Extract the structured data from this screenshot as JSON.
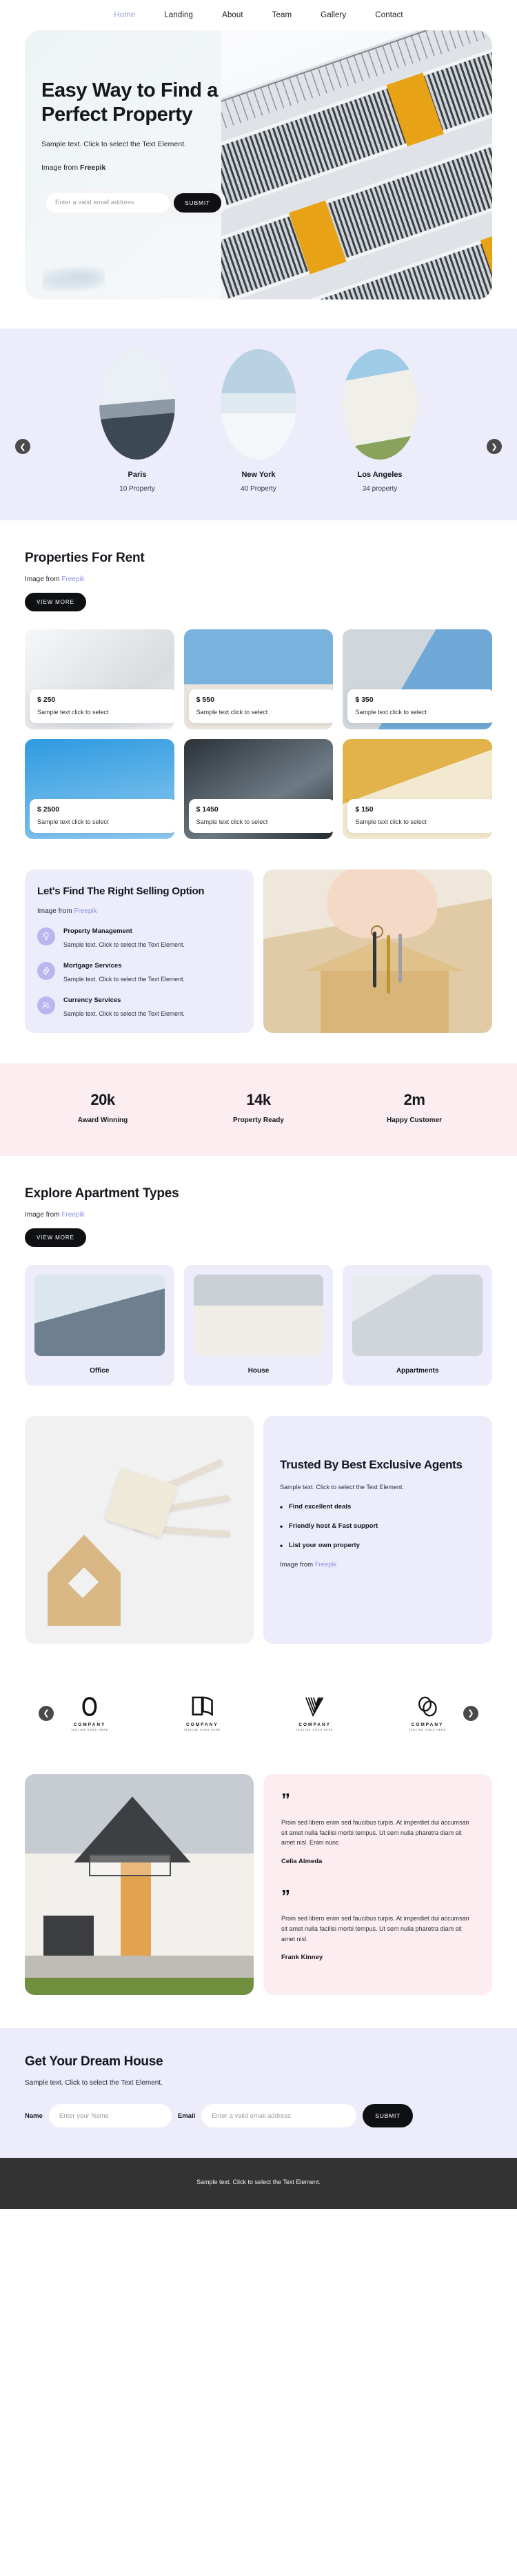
{
  "nav": {
    "items": [
      {
        "label": "Home",
        "active": true
      },
      {
        "label": "Landing",
        "active": false
      },
      {
        "label": "About",
        "active": false
      },
      {
        "label": "Team",
        "active": false
      },
      {
        "label": "Gallery",
        "active": false
      },
      {
        "label": "Contact",
        "active": false
      }
    ]
  },
  "hero": {
    "title": "Easy Way to Find a Perfect Property",
    "subtitle": "Sample text. Click to select the Text Element.",
    "credit_prefix": "Image from ",
    "credit_link": "Freepik",
    "email_placeholder": "Enter a valid email address",
    "submit_label": "SUBMIT"
  },
  "cities": {
    "prev_icon": "chevron-left-icon",
    "next_icon": "chevron-right-icon",
    "items": [
      {
        "name": "Paris",
        "count": "10 Property"
      },
      {
        "name": "New York",
        "count": "40 Property"
      },
      {
        "name": "Los Angeles",
        "count": "34 property"
      }
    ]
  },
  "properties": {
    "title": "Properties For Rent",
    "credit_prefix": "Image from ",
    "credit_link": "Freepik",
    "view_more_label": "VIEW MORE",
    "cards": [
      {
        "price": "$ 250",
        "text": "Sample text click to select"
      },
      {
        "price": "$ 550",
        "text": "Sample text click to select"
      },
      {
        "price": "$ 350",
        "text": "Sample text click to select"
      },
      {
        "price": "$ 2500",
        "text": "Sample text click to select"
      },
      {
        "price": "$ 1450",
        "text": "Sample text click to select"
      },
      {
        "price": "$ 150",
        "text": "Sample text click to select"
      }
    ]
  },
  "selling": {
    "title": "Let's Find The Right Selling Option",
    "credit_prefix": "Image from ",
    "credit_link": "Freepik",
    "features": [
      {
        "icon": "lightbulb-icon",
        "title": "Property Management",
        "text": "Sample text. Click to select the Text Element."
      },
      {
        "icon": "gear-icon",
        "title": "Mortgage Services",
        "text": "Sample text. Click to select the Text Element."
      },
      {
        "icon": "people-icon",
        "title": "Currency Services",
        "text": "Sample text. Click to select the Text Element."
      }
    ]
  },
  "stats": [
    {
      "number": "20k",
      "label": "Award Winning"
    },
    {
      "number": "14k",
      "label": "Property Ready"
    },
    {
      "number": "2m",
      "label": "Happy Customer"
    }
  ],
  "apartments": {
    "title": "Explore Apartment Types",
    "credit_prefix": "Image from ",
    "credit_link": "Freepik",
    "view_more_label": "VIEW MORE",
    "types": [
      {
        "name": "Office"
      },
      {
        "name": "House"
      },
      {
        "name": "Appartments"
      }
    ]
  },
  "trusted": {
    "title": "Trusted By Best Exclusive Agents",
    "subtitle": "Sample text. Click to select the Text Element.",
    "bullets": [
      "Find excellent deals",
      "Friendly host & Fast support",
      "List your own property"
    ],
    "credit_prefix": "Image from ",
    "credit_link": "Freepik"
  },
  "logos": {
    "prev_icon": "chevron-left-icon",
    "next_icon": "chevron-right-icon",
    "items": [
      {
        "mark": "oval-loop-logo",
        "name": "COMPANY",
        "tagline": "TAGLINE GOES HERE"
      },
      {
        "mark": "open-book-logo",
        "name": "COMPANY",
        "tagline": "TAGLINE GOES HERE"
      },
      {
        "mark": "v-lines-logo",
        "name": "COMPANY",
        "tagline": "TAGLINE GOES HERE"
      },
      {
        "mark": "double-ring-logo",
        "name": "COMPANY",
        "tagline": "TAGLINE GOES HERE"
      }
    ]
  },
  "testimonials": [
    {
      "quote_icon": "quote-mark-icon",
      "text": "Proin sed libero enim sed faucibus turpis. At imperdiet dui accumsan sit amet nulla facilisi morbi tempus. Ut sem nulla pharetra diam sit amet nisl. Enim nunc",
      "author": "Celia Almeda"
    },
    {
      "quote_icon": "quote-mark-icon",
      "text": "Proin sed libero enim sed faucibus turpis. At imperdiet dui accumsan sit amet nulla facilisi morbi tempus. Ut sem nulla pharetra diam sit amet nisl.",
      "author": "Frank Kinney"
    }
  ],
  "cta": {
    "title": "Get Your Dream House",
    "subtitle": "Sample text. Click to select the Text Element.",
    "name_label": "Name",
    "name_placeholder": "Enter your Name",
    "email_label": "Email",
    "email_placeholder": "Enter a valid email address",
    "submit_label": "SUBMIT"
  },
  "footer": {
    "text": "Sample text. Click to select the Text Element."
  },
  "colors": {
    "accent_lavender": "#ececfb",
    "accent_pink": "#fceef0",
    "dark": "#0f1013",
    "link": "#8e92df",
    "nav_active": "#9b9fe0",
    "footer_bg": "#333333",
    "icon_circle": "#b9b5ee"
  }
}
